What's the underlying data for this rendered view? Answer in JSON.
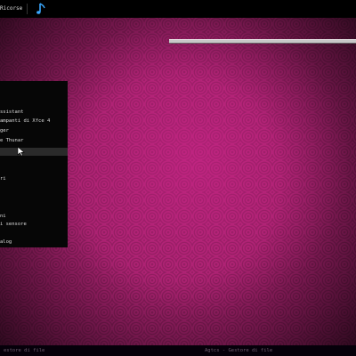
{
  "top_panel": {
    "launcher_title": "Ricorse",
    "music_icon": "music-note-icon",
    "music_icon_color": "#3aa8ff"
  },
  "app_menu": {
    "items": [
      {
        "label": ""
      },
      {
        "label": "ssistant"
      },
      {
        "label": "ampanti di Xfce 4"
      },
      {
        "label": "ger"
      },
      {
        "label": "e Thunar"
      },
      {
        "label": ""
      },
      {
        "label": ""
      },
      {
        "label": "ri"
      },
      {
        "label": ""
      },
      {
        "label": ""
      },
      {
        "label": "ni"
      },
      {
        "label": "i sensore"
      },
      {
        "label": ""
      },
      {
        "label": "alog"
      }
    ],
    "highlighted_index": 8
  },
  "bottom_panel": {
    "task_left": "estore di file",
    "task_right": "Agtcs - Gestore di file"
  },
  "colors": {
    "desktop": "#a8226f",
    "panel": "#000000",
    "menu_bg": "#060606",
    "highlight": "#2a2a2a"
  }
}
